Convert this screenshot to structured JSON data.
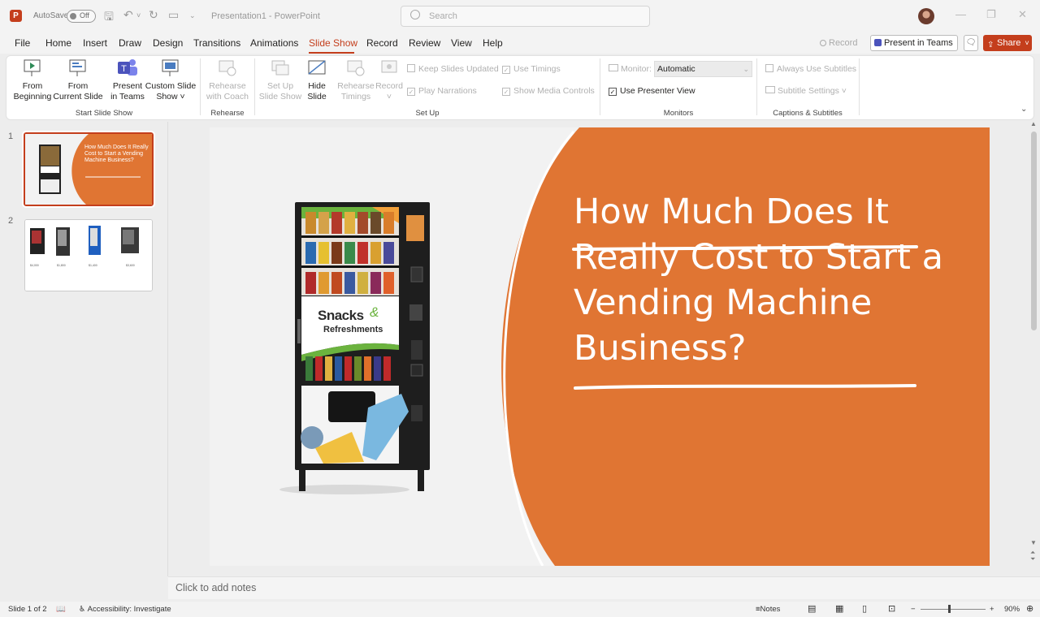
{
  "titlebar": {
    "autosave_label": "AutoSave",
    "autosave_state": "Off",
    "document_title": "Presentation1 - PowerPoint",
    "search_placeholder": "Search"
  },
  "menu": {
    "tabs": [
      "File",
      "Home",
      "Insert",
      "Draw",
      "Design",
      "Transitions",
      "Animations",
      "Slide Show",
      "Record",
      "Review",
      "View",
      "Help"
    ],
    "active_tab": "Slide Show",
    "record_label": "Record",
    "present_teams_label": "Present in Teams",
    "share_label": "Share"
  },
  "ribbon": {
    "from_beginning": [
      "From",
      "Beginning"
    ],
    "from_current": [
      "From",
      "Current Slide"
    ],
    "present_teams": [
      "Present",
      "in Teams"
    ],
    "custom_show": [
      "Custom Slide",
      "Show ˅"
    ],
    "group_start": "Start Slide Show",
    "rehearse_coach": [
      "Rehearse",
      "with Coach"
    ],
    "group_rehearse": "Rehearse",
    "setup_show": [
      "Set Up",
      "Slide Show"
    ],
    "hide_slide": [
      "Hide",
      "Slide"
    ],
    "rehearse_timings": [
      "Rehearse",
      "Timings"
    ],
    "record_btn": "Record",
    "keep_updated": "Keep Slides Updated",
    "play_narrations": "Play Narrations",
    "use_timings": "Use Timings",
    "show_media": "Show Media Controls",
    "group_setup": "Set Up",
    "monitor_label": "Monitor:",
    "monitor_value": "Automatic",
    "presenter_view": "Use Presenter View",
    "group_monitors": "Monitors",
    "always_subtitles": "Always Use Subtitles",
    "subtitle_settings": "Subtitle Settings ˅",
    "group_captions": "Captions & Subtitles"
  },
  "thumbnails": {
    "slide1_num": "1",
    "slide1_title": "How Much Does It Really Cost to Start a Vending Machine Business?",
    "slide2_num": "2",
    "slide2_prices": [
      "$4,000",
      "$1,800",
      "$1,400",
      "$3,600"
    ]
  },
  "slide": {
    "title": "How Much Does It Really Cost to Start a Vending Machine Business?",
    "panel_text": [
      "Snacks",
      "&",
      "Refreshments"
    ],
    "accent": "#e07533"
  },
  "notes_placeholder": "Click to add notes",
  "status": {
    "slide_info": "Slide 1 of 2",
    "accessibility": "Accessibility: Investigate",
    "notes_label": "Notes",
    "zoom": "90%"
  }
}
